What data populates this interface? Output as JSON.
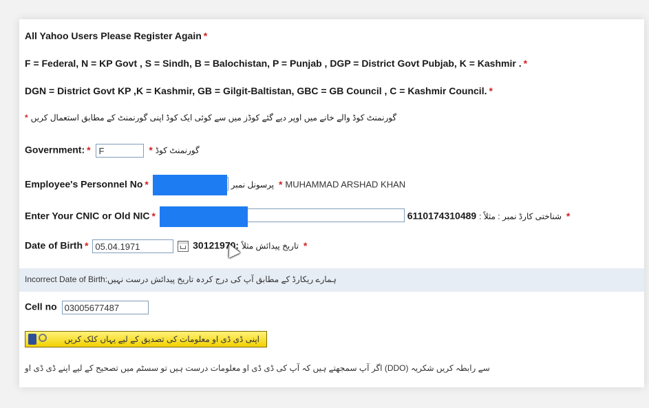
{
  "notice": {
    "register": "All Yahoo Users Please Register Again",
    "codes_line1": "F = Federal, N = KP Govt , S = Sindh, B = Balochistan, P = Punjab , DGP = District Govt Pubjab, K = Kashmir .",
    "codes_line2": "DGN = District Govt KP ,K = Kashmir, GB = Gilgit-Baltistan, GBC = GB Council , C = Kashmir Council.",
    "urdu_instruction": "گورنمنٹ کوڈ والے خانے میں اوپر دیے گئے کوڈز میں سے کوئی ایک کوڈ اپنی گورنمنٹ کے مطابق استعمال کریں",
    "required_mark": "*"
  },
  "government": {
    "label": "Government:",
    "value": "F",
    "urdu_label": "گورنمنٹ کوڈ"
  },
  "personnel": {
    "label": "Employee's Personnel No",
    "urdu_label": "پرسونل نمبر",
    "employee_name": "MUHAMMAD ARSHAD KHAN"
  },
  "cnic": {
    "label": "Enter Your CNIC or Old NIC",
    "example": "6110174310489",
    "urdu_label": "شناختی کارڈ نمبر : مثلاً :"
  },
  "dob": {
    "label": "Date of Birth",
    "value": "05.04.1971",
    "example": "30121970:",
    "urdu_label": "تاریخ پیدائش مثلاً"
  },
  "error": {
    "text": "Incorrect Date of Birth:",
    "urdu_text": "ہمارے ریکارڈ کے مطابق آپ کی درج کردہ تاریخ پیدائش درست نہیں"
  },
  "cell": {
    "label": "Cell no",
    "value": "03005677487"
  },
  "verify_button": {
    "label": "اپنی ڈی ڈی او معلومات کی تصدیق کے لیے یہاں کلک کریں"
  },
  "footer": {
    "text": "سے رابطہ کریں شکریہ (DDO) اگر آپ سمجھتے ہیں کہ آپ کی ڈی ڈی او معلومات درست ہیں تو سسٹم میں تصحیح کے لیے اپنے ڈی ڈی او"
  },
  "colors": {
    "required": "#d31f1f",
    "redaction": "#1e7cf2",
    "highlight_band": "#e7edf5",
    "button_yellow": "#f2d100"
  }
}
